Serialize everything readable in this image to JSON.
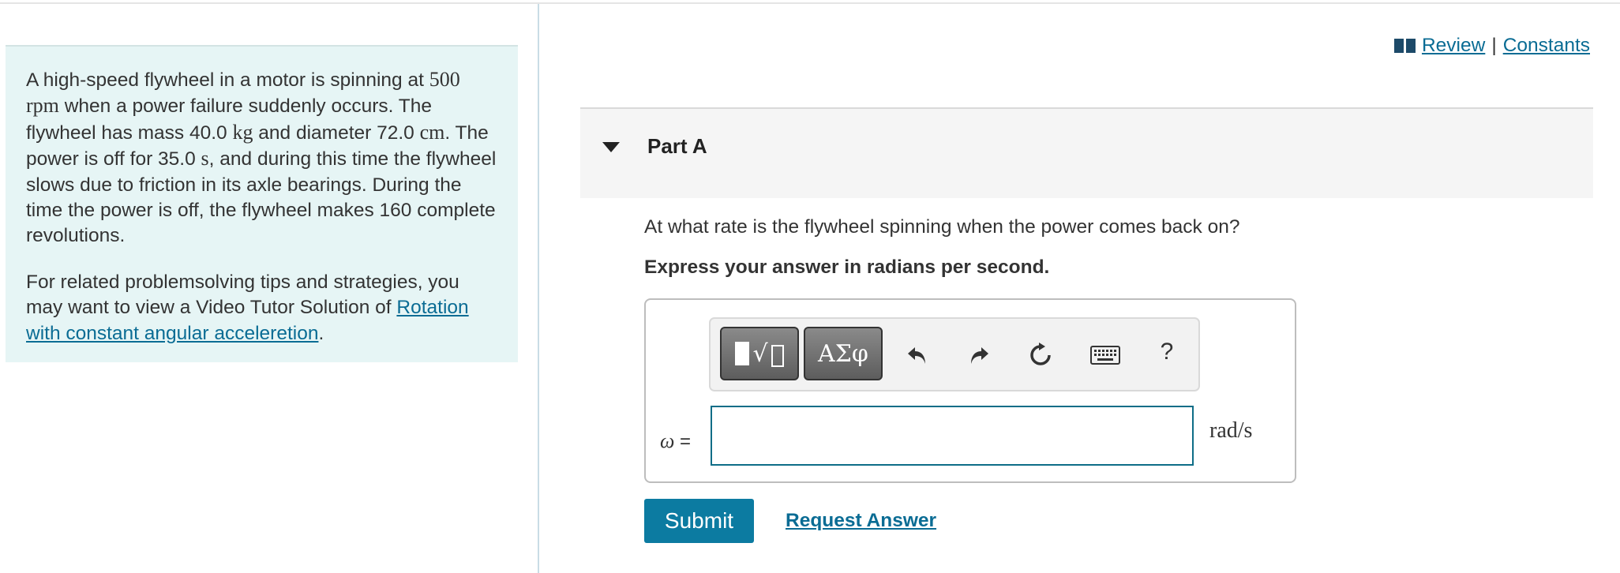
{
  "problem": {
    "para1": {
      "t1": "A high-speed flywheel in a motor is spinning at",
      "v1": "500",
      "u1": "rpm",
      "t2": "when a power failure suddenly occurs. The flywheel has mass 40.0",
      "u2": "kg",
      "t3": "and diameter 72.0",
      "u3": "cm",
      "t4": ". The power is off for 35.0",
      "u4": "s",
      "t5": ", and during this time the flywheel slows due to friction in its axle bearings. During the time the power is off, the flywheel makes 160 complete revolutions."
    },
    "para2": {
      "text": "For related problemsolving tips and strategies, you may want to view a Video Tutor Solution of",
      "link": "Rotation with constant angular acceleretion",
      "end": "."
    }
  },
  "toplinks": {
    "review": "Review",
    "separator": "|",
    "constants": "Constants",
    "icon": "book-icon"
  },
  "part": {
    "title": "Part A",
    "question": "At what rate is the flywheel spinning when the power comes back on?",
    "instruction": "Express your answer in radians per second."
  },
  "toolbar": {
    "symbols_label": "ΑΣφ",
    "help_label": "?",
    "icons": [
      "templates-icon",
      "undo-icon",
      "redo-icon",
      "reset-icon",
      "keyboard-icon",
      "help-icon"
    ]
  },
  "answer": {
    "variable": "ω",
    "equals": "=",
    "value": "",
    "unit": "rad/s"
  },
  "actions": {
    "submit": "Submit",
    "request_answer": "Request Answer"
  },
  "colors": {
    "panel_bg": "#e6f5f5",
    "link": "#0a6c94",
    "submit_bg": "#0c7ba1",
    "input_border": "#0e6d87"
  }
}
